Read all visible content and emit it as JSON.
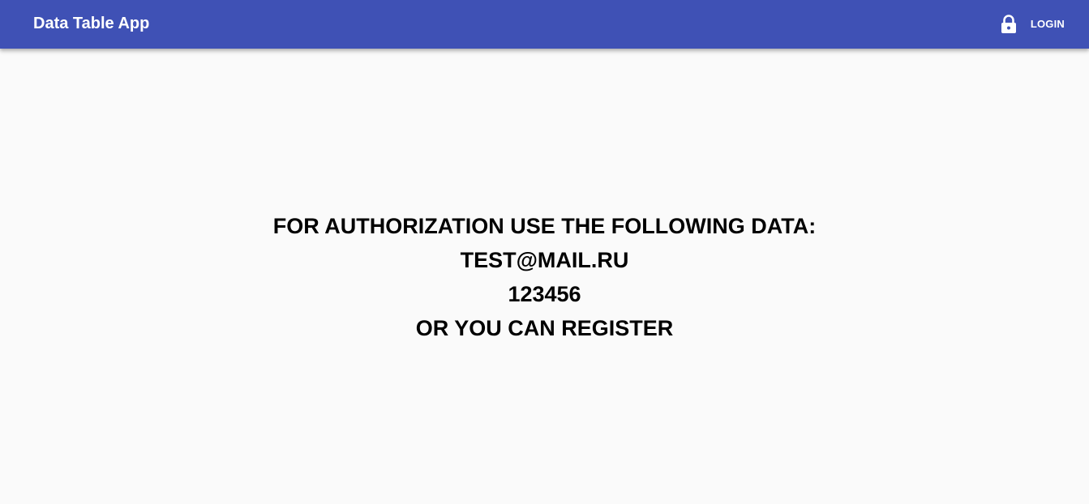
{
  "app_bar": {
    "title": "Data Table App",
    "login_label": "LOGIN",
    "login_icon": "lock-icon",
    "background_color": "#3f51b5",
    "text_color": "#ffffff"
  },
  "main": {
    "background_color": "#fafafa",
    "lines": [
      "FOR AUTHORIZATION USE THE FOLLOWING DATA:",
      "TEST@MAIL.RU",
      "123456",
      "OR YOU CAN REGISTER"
    ]
  }
}
